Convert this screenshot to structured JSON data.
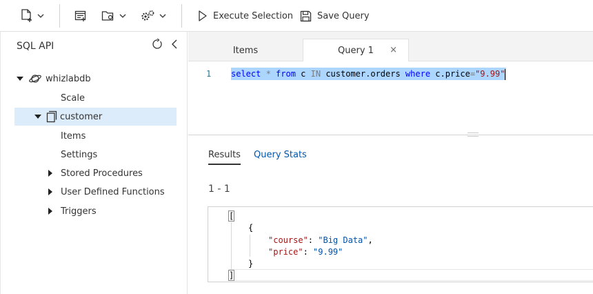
{
  "toolbar": {
    "execute_label": "Execute Selection",
    "save_label": "Save Query"
  },
  "sidebar": {
    "title": "SQL API",
    "database": "whizlabdb",
    "db_scale": "Scale",
    "container": "customer",
    "items": "Items",
    "settings": "Settings",
    "stored_procedures": "Stored Procedures",
    "udfs": "User Defined Functions",
    "triggers": "Triggers"
  },
  "tabs": {
    "items": "Items",
    "query": "Query 1",
    "close": "×"
  },
  "editor": {
    "line_number": "1",
    "tokens": {
      "t1": "select",
      "t2": " * ",
      "t3": "from",
      "t4": " c ",
      "t5": "IN",
      "t6": " customer.orders ",
      "t7": "where",
      "t8": " c.price",
      "t9": "=",
      "t10": "\"9.99\""
    }
  },
  "results": {
    "tab_results": "Results",
    "tab_stats": "Query Stats",
    "range": "1 - 1",
    "json": {
      "open_array": "[",
      "open_obj": "{",
      "key1": "\"course\"",
      "val1": "\"Big Data\"",
      "key2": "\"price\"",
      "val2": "\"9.99\"",
      "close_obj": "}",
      "close_array": "]"
    }
  },
  "colors": {
    "accent": "#0058ad",
    "selection": "#add6ff",
    "tree_selected": "#dcecfb"
  }
}
